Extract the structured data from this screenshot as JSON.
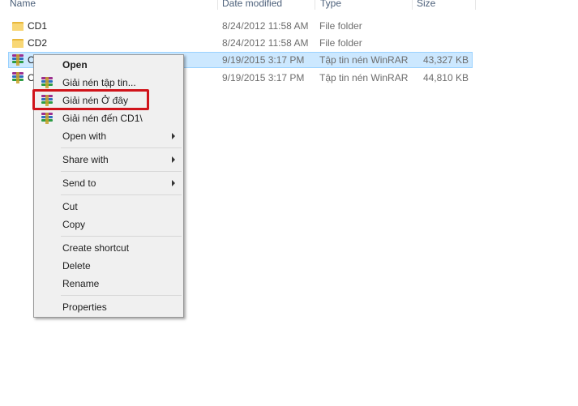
{
  "header": {
    "name": "Name",
    "date_modified": "Date modified",
    "type": "Type",
    "size": "Size"
  },
  "files": [
    {
      "name": "CD1",
      "date": "8/24/2012 11:58 AM",
      "type": "File folder",
      "size": "",
      "icon": "folder-icon"
    },
    {
      "name": "CD2",
      "date": "8/24/2012 11:58 AM",
      "type": "File folder",
      "size": "",
      "icon": "folder-icon"
    },
    {
      "name": "C",
      "date": "9/19/2015 3:17 PM",
      "type": "Tập tin nén WinRAR",
      "size": "43,327 KB",
      "icon": "winrar-archive-icon",
      "selected": true
    },
    {
      "name": "C",
      "date": "9/19/2015 3:17 PM",
      "type": "Tập tin nén WinRAR",
      "size": "44,810 KB",
      "icon": "winrar-archive-icon"
    }
  ],
  "context_menu": {
    "open": "Open",
    "extract_files": "Giải nén tập tin...",
    "extract_here": "Giải nén Ở đây",
    "extract_to": "Giải nén đến CD1\\",
    "open_with": "Open with",
    "share_with": "Share with",
    "send_to": "Send to",
    "cut": "Cut",
    "copy": "Copy",
    "create_shortcut": "Create shortcut",
    "delete": "Delete",
    "rename": "Rename",
    "properties": "Properties"
  },
  "colors": {
    "highlight_border": "#d0141b",
    "selection_bg": "#cce8ff",
    "menu_bg": "#f0f0f0"
  }
}
